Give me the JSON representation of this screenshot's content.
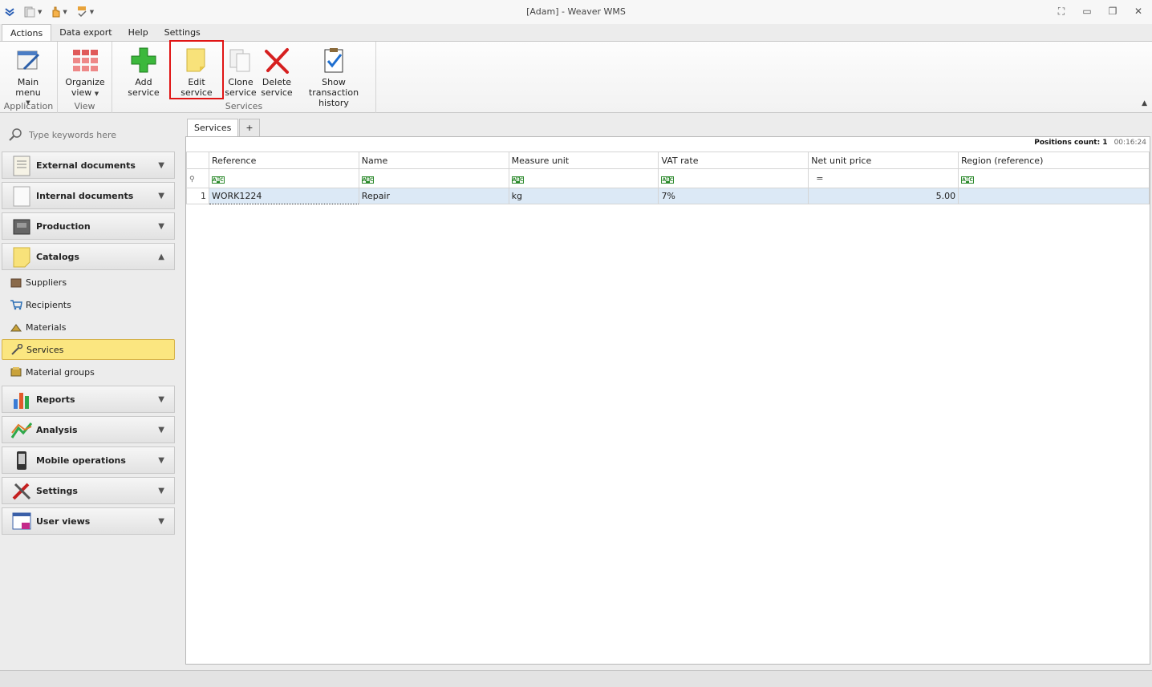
{
  "window": {
    "title": "[Adam] - Weaver WMS"
  },
  "ribbon": {
    "tabs": [
      "Actions",
      "Data export",
      "Help",
      "Settings"
    ],
    "groups": {
      "application": "Application",
      "view": "View",
      "services": "Services"
    },
    "buttons": {
      "main_menu": "Main menu",
      "organize_view_1": "Organize",
      "organize_view_2": "view",
      "add_service": "Add service",
      "edit_service": "Edit service",
      "clone_1": "Clone",
      "clone_2": "service",
      "delete_1": "Delete",
      "delete_2": "service",
      "history_1": "Show transaction",
      "history_2": "history"
    }
  },
  "sidebar": {
    "search_placeholder": "Type keywords here",
    "groups": {
      "external": "External documents",
      "internal": "Internal documents",
      "production": "Production",
      "catalogs": "Catalogs",
      "reports": "Reports",
      "analysis": "Analysis",
      "mobile": "Mobile operations",
      "settings": "Settings",
      "user_views": "User views"
    },
    "catalog_items": {
      "suppliers": "Suppliers",
      "recipients": "Recipients",
      "materials": "Materials",
      "services": "Services",
      "material_groups": "Material groups"
    }
  },
  "main": {
    "tab_label": "Services",
    "add_tab": "+",
    "positions_count": "Positions count: 1",
    "time": "00:16:24",
    "columns": [
      "Reference",
      "Name",
      "Measure unit",
      "VAT rate",
      "Net unit price",
      "Region (reference)"
    ],
    "filter_number_symbol": "=",
    "rows": [
      {
        "num": "1",
        "reference": "WORK1224",
        "name": "Repair",
        "unit": "kg",
        "vat": "7%",
        "price": "5.00",
        "region": ""
      }
    ]
  }
}
